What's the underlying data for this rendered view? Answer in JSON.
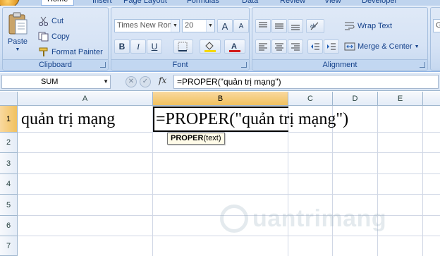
{
  "ribbon": {
    "tabs": [
      "Home",
      "Insert",
      "Page Layout",
      "Formulas",
      "Data",
      "Review",
      "View",
      "Developer"
    ],
    "clipboard": {
      "label": "Clipboard",
      "paste": "Paste",
      "cut": "Cut",
      "copy": "Copy",
      "format_painter": "Format Painter"
    },
    "font": {
      "label": "Font",
      "font_name": "Times New Rom",
      "font_size": "20",
      "bold": "B",
      "italic": "I",
      "underline": "U",
      "grow": "A",
      "shrink": "A"
    },
    "alignment": {
      "label": "Alignment",
      "wrap_text": "Wrap Text",
      "merge_center": "Merge & Center"
    },
    "number": {
      "format_value": "G"
    }
  },
  "formula_bar": {
    "name_box": "SUM",
    "fx": "fx",
    "formula": "=PROPER(\"quản trị mạng\")"
  },
  "grid": {
    "columns": [
      "A",
      "B",
      "C",
      "D",
      "E"
    ],
    "rows": [
      "1",
      "2",
      "3",
      "4",
      "5",
      "6",
      "7"
    ],
    "cells": {
      "A1": "quản trị mạng",
      "B1": "=PROPER(\"quản trị mạng\")"
    },
    "tooltip": {
      "func": "PROPER",
      "args": "(text)"
    }
  },
  "watermark": {
    "text": "uantrimang"
  }
}
